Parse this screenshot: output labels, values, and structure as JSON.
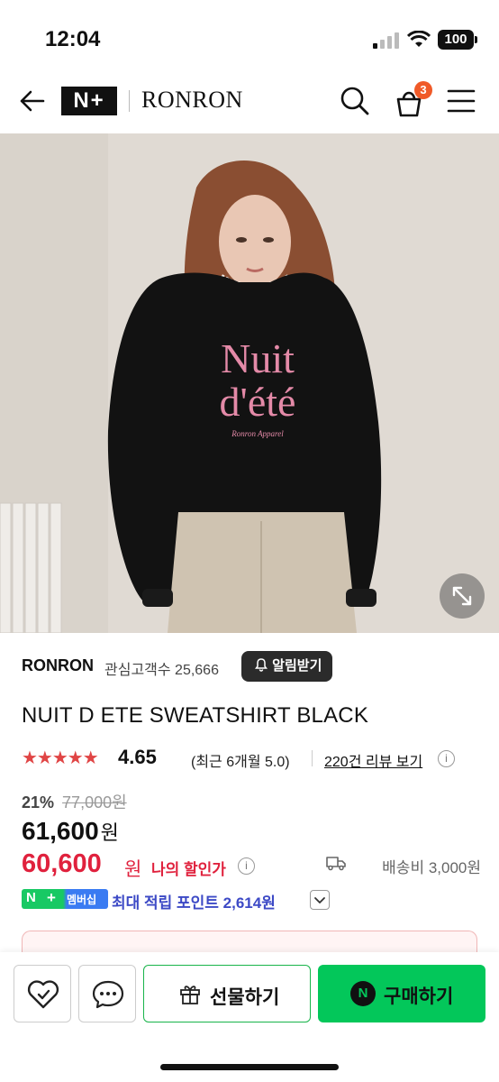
{
  "status": {
    "time": "12:04",
    "battery": "100"
  },
  "header": {
    "n_logo": "N+",
    "brand": "RONRON",
    "cart_count": "3"
  },
  "shop": {
    "name": "RONRON",
    "favorites": "관심고객수 25,666",
    "alarm_label": "알림받기"
  },
  "product": {
    "name": "NUIT D ETE SWEATSHIRT BLACK",
    "rating_stars": "★★★★★",
    "rating": "4.65",
    "rating_recent": "(최근 6개월 5.0)",
    "reviews_link": "220건 리뷰 보기",
    "discount_pct": "21%",
    "original_price": "77,000원",
    "price": "61,600",
    "price_unit": "원",
    "my_price": "60,600",
    "my_price_unit": "원",
    "my_price_label": "나의 할인가",
    "shipping": "배송비 3,000원",
    "membership_badge_n": "N",
    "membership_badge_plus": "+",
    "membership_badge_text": "멤버십",
    "points_text": "최대 적립 포인트 2,614원",
    "sweatshirt_print_line1": "Nuit",
    "sweatshirt_print_line2": "d'été",
    "sweatshirt_print_small": "Ronron Apparel"
  },
  "bottom": {
    "gift_label": "선물하기",
    "buy_label": "구매하기",
    "buy_badge": "N"
  },
  "colors": {
    "naver_green": "#03c75a",
    "price_red": "#e0213d",
    "points_purple": "#3d4ac6",
    "cart_badge": "#f05a28"
  }
}
